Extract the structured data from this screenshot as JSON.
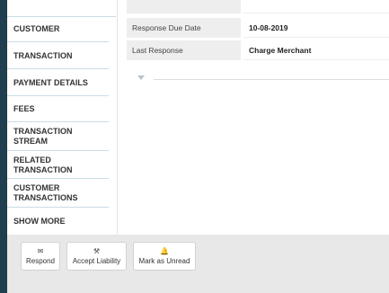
{
  "sidebar": {
    "items": [
      {
        "label": "CUSTOMER"
      },
      {
        "label": "TRANSACTION"
      },
      {
        "label": "PAYMENT DETAILS"
      },
      {
        "label": "FEES"
      },
      {
        "label": "TRANSACTION",
        "label2": "STREAM"
      },
      {
        "label": "RELATED",
        "label2": "TRANSACTION"
      },
      {
        "label": "CUSTOMER",
        "label2": "TRANSACTIONS"
      },
      {
        "label": "SHOW MORE"
      }
    ]
  },
  "details": {
    "fields": [
      {
        "label": "Response Due Date",
        "value": "10-08-2019"
      },
      {
        "label": "Last Response",
        "value": "Charge Merchant"
      }
    ]
  },
  "footer": {
    "actions": [
      {
        "label": "Respond",
        "icon": "envelope-icon",
        "glyph": "✉"
      },
      {
        "label": "Accept Liability",
        "icon": "gavel-icon",
        "glyph": "⚒"
      },
      {
        "label": "Mark as Unread",
        "icon": "bell-icon",
        "glyph": "🔔"
      }
    ]
  },
  "colors": {
    "sidebar_strip": "#1f3f4f",
    "divider": "#c8dde5",
    "label_bg": "#eeeeee",
    "footer_bg": "#e8e8e8"
  }
}
